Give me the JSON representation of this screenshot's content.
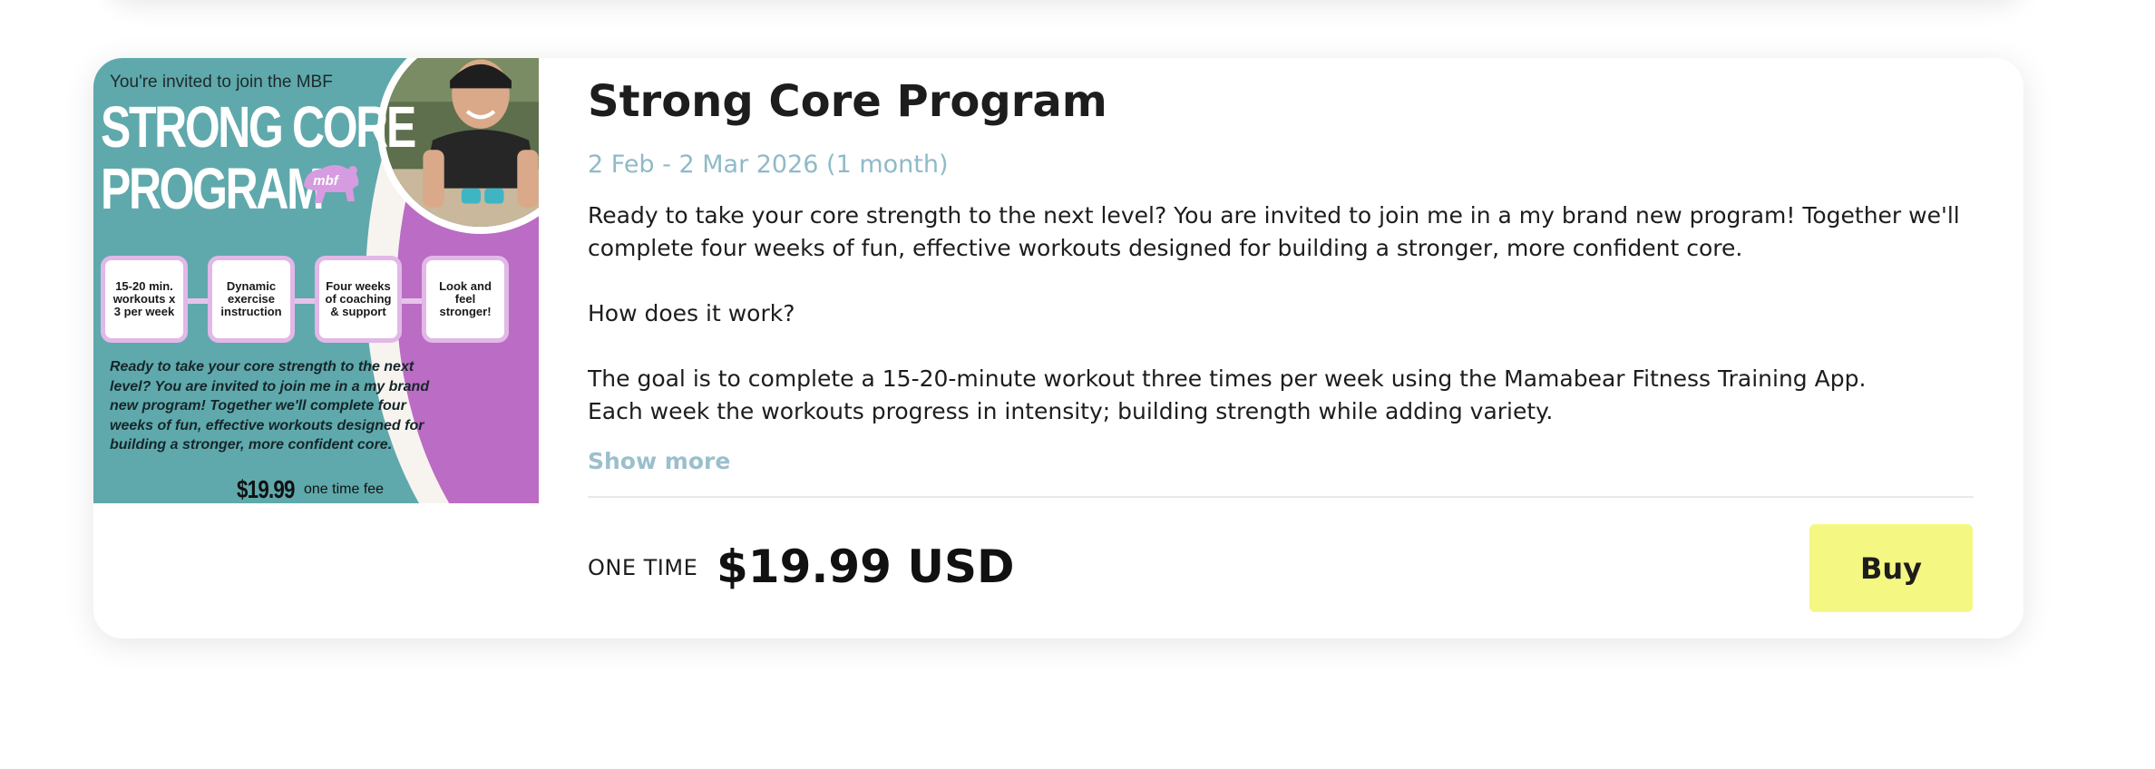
{
  "product": {
    "title": "Strong Core Program",
    "dates": "2 Feb - 2 Mar 2026 (1 month)",
    "description": [
      "Ready to take your core strength to the next level?  You are invited to join me in a my brand new program! Together we'll complete four weeks of fun, effective workouts designed for building a stronger, more confident core.",
      "How does it work?",
      "The goal is to complete a 15-20-minute workout three times per week using the Mamabear Fitness Training App.\n Each week the workouts progress in intensity; building strength while adding variety."
    ],
    "show_more_label": "Show more",
    "price_type_label": "ONE TIME",
    "price": "$19.99 USD",
    "buy_label": "Buy"
  },
  "promo_image": {
    "invite_text": "You're invited to join the MBF",
    "title_line1": "STRONG CORE",
    "title_line2": "PROGRAM",
    "badge_text": "mbf",
    "features": [
      "15-20 min. workouts x 3 per week",
      "Dynamic exercise instruction",
      "Four weeks of coaching & support",
      "Look and feel stronger!"
    ],
    "body_text": "Ready to take your core strength to the next level?  You are invited to join me in a my brand new program! Together we'll complete four weeks of fun, effective workouts designed for building a stronger, more confident core.",
    "price": "$19.99",
    "fee_label": "one time fee"
  },
  "colors": {
    "dates_text": "#8fbac8",
    "show_more": "#9bbfcc",
    "buy_button": "#f5f783",
    "promo_teal": "#5fa9ac",
    "promo_purple": "#bb6cc4",
    "promo_box_border": "#e2b8e8"
  }
}
